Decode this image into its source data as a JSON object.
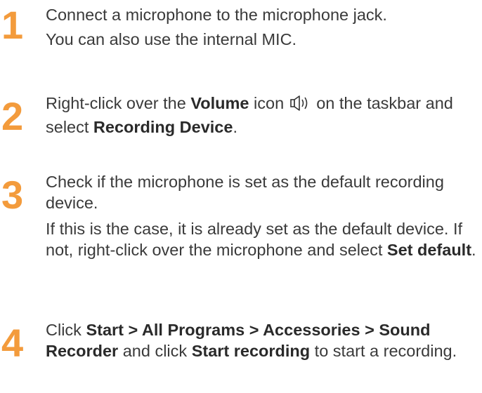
{
  "step1": {
    "number": "1",
    "line1": "Connect a microphone to the microphone jack.",
    "line2": "You can also use the internal MIC."
  },
  "step2": {
    "number": "2",
    "t1": "Right-click over the ",
    "b1": "Volume",
    "t2": " icon ",
    "icon": "speaker-volume-icon",
    "t3": " on the taskbar and select ",
    "b2": "Recording Device",
    "t4": "."
  },
  "step3": {
    "number": "3",
    "p1": "Check if the microphone is set as the default recording device.",
    "p2_t1": "If this is the case, it is already set as the default device. If not, right-click over the microphone and select ",
    "p2_b1": "Set default",
    "p2_t2": "."
  },
  "step4": {
    "number": "4",
    "t1": "Click ",
    "b1": "Start > All Programs > Accessories > Sound Recorder",
    "t2": " and click ",
    "b2": "Start recording",
    "t3": " to start a recording."
  },
  "colors": {
    "step_number": "#f39b3c",
    "text": "#3a3a3a"
  }
}
